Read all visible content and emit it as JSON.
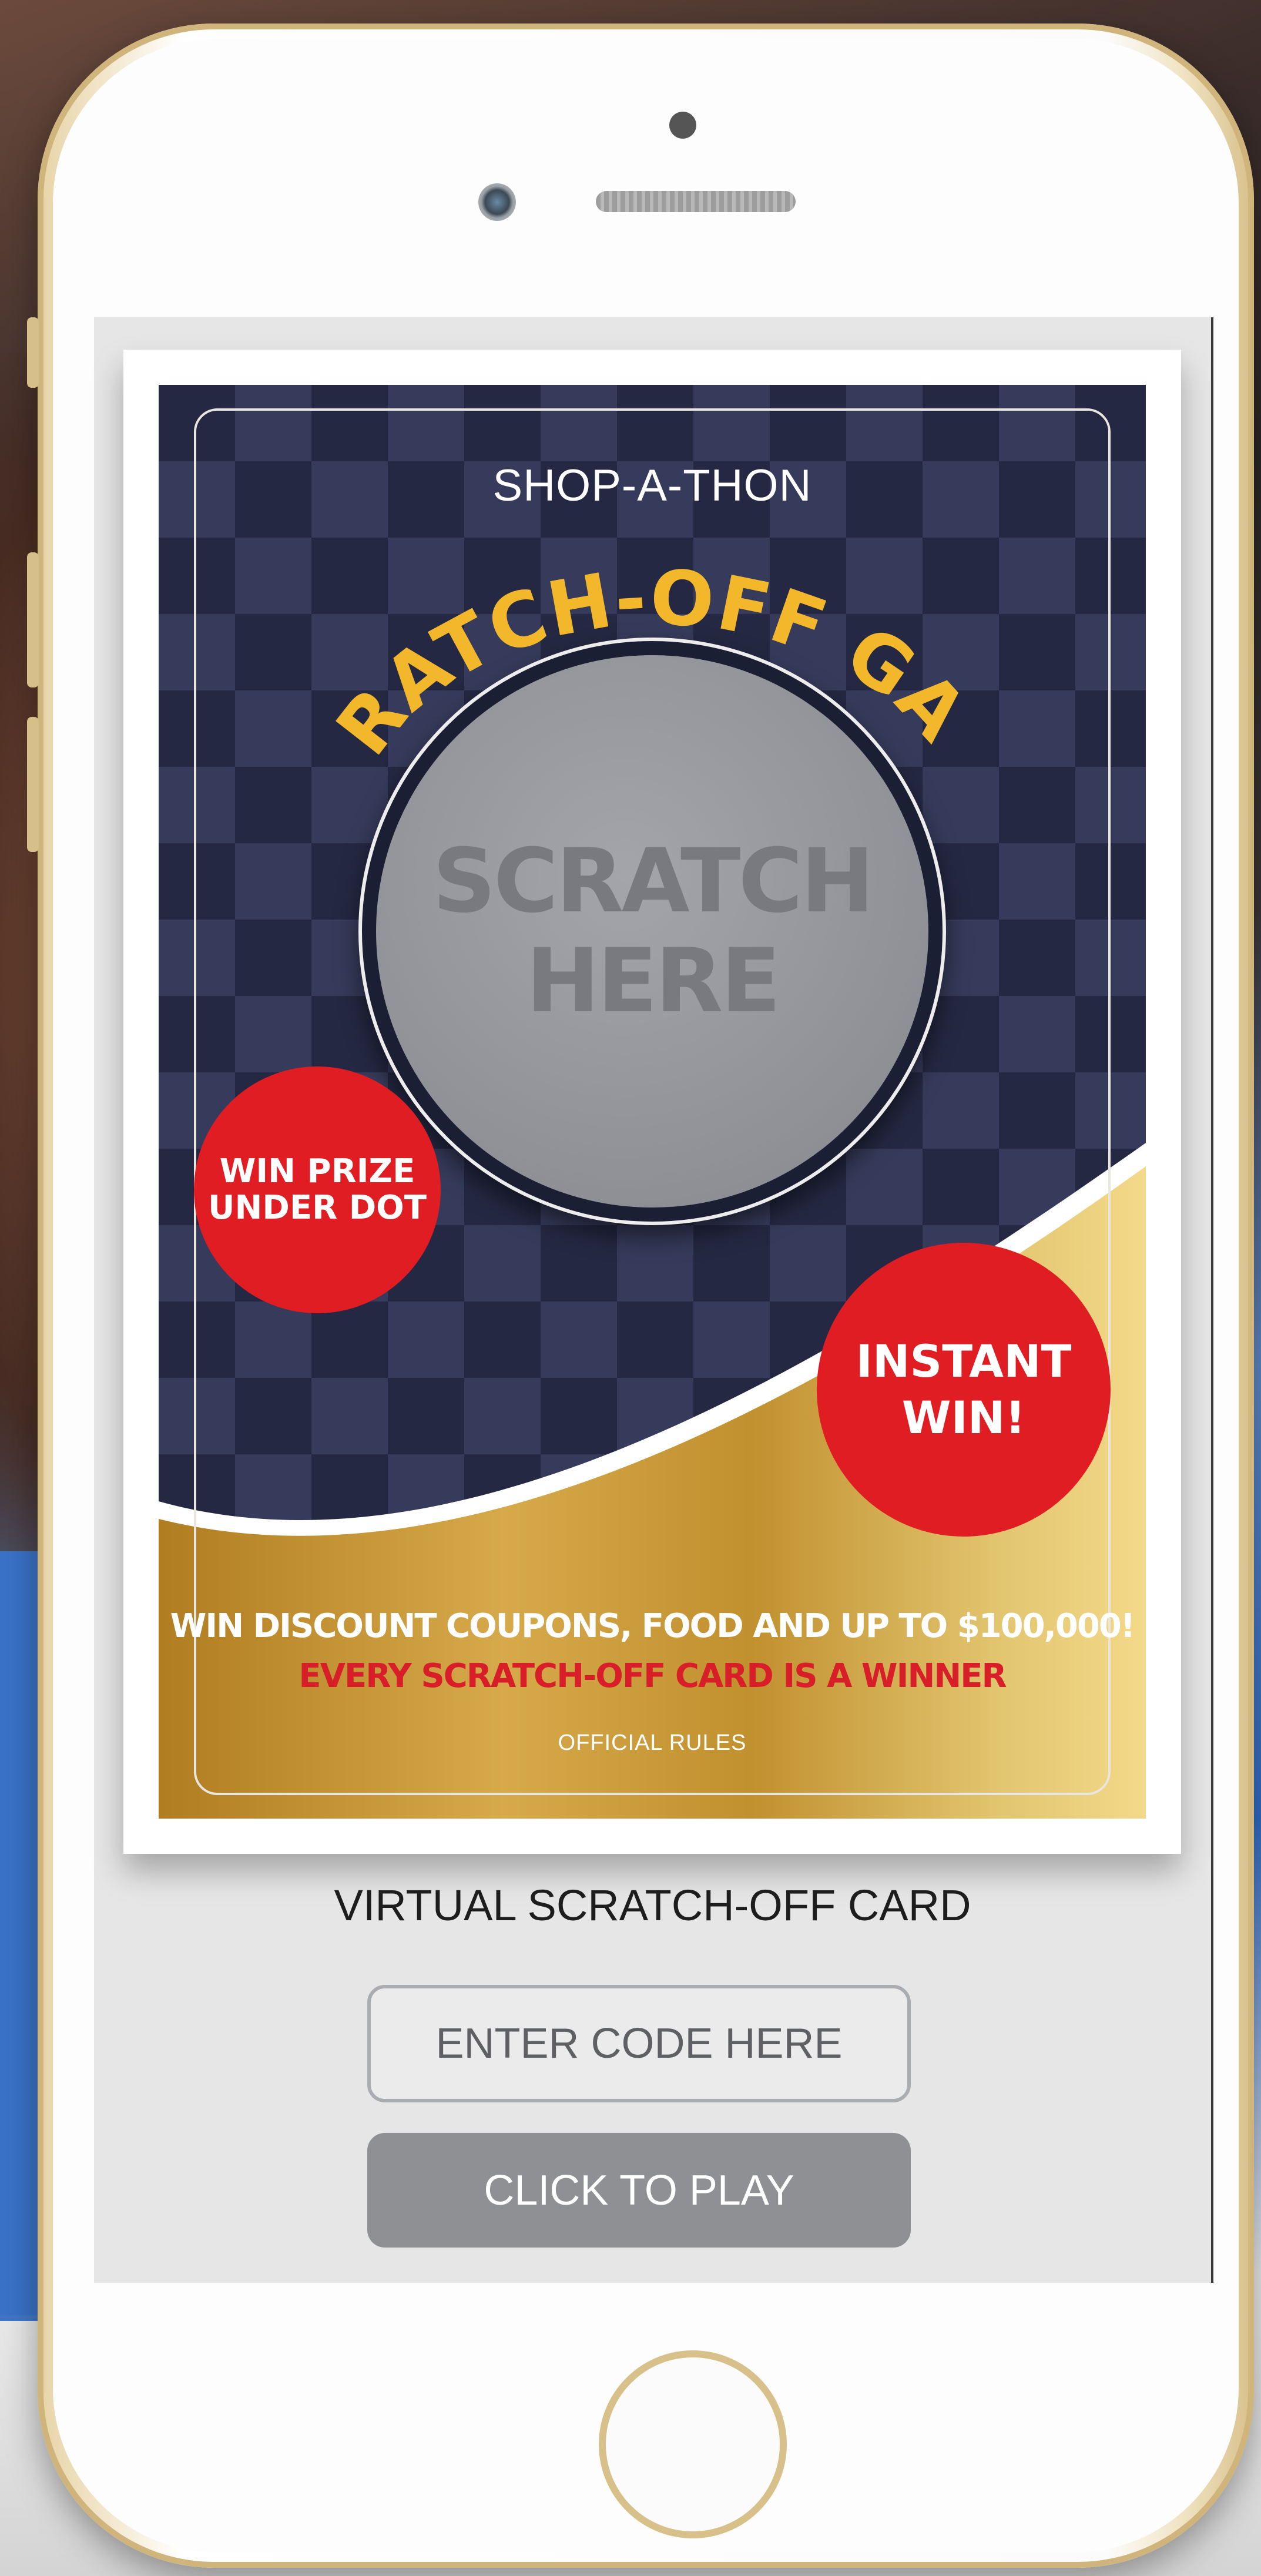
{
  "card": {
    "brand": "SHOP-A-THON",
    "title": "SCRATCH-OFF GAME",
    "scratch_text": "SCRATCH\nHERE",
    "badge_left": "WIN PRIZE\nUNDER DOT",
    "badge_right": "INSTANT\nWIN!",
    "promo_line1": "WIN DISCOUNT COUPONS, FOOD AND UP TO $100,000!",
    "promo_line2": "EVERY SCRATCH-OFF CARD IS A WINNER",
    "rules_link": "OFFICIAL RULES"
  },
  "caption": "VIRTUAL SCRATCH-OFF CARD",
  "code_input": {
    "placeholder": "ENTER CODE HERE",
    "value": ""
  },
  "play_button": {
    "label": "CLICK TO PLAY"
  },
  "colors": {
    "title_gold": "#f2b72a",
    "badge_red": "#e11d24",
    "promo_red": "#d81e28",
    "card_navy": "#242842",
    "button_gray": "#8f9094"
  }
}
